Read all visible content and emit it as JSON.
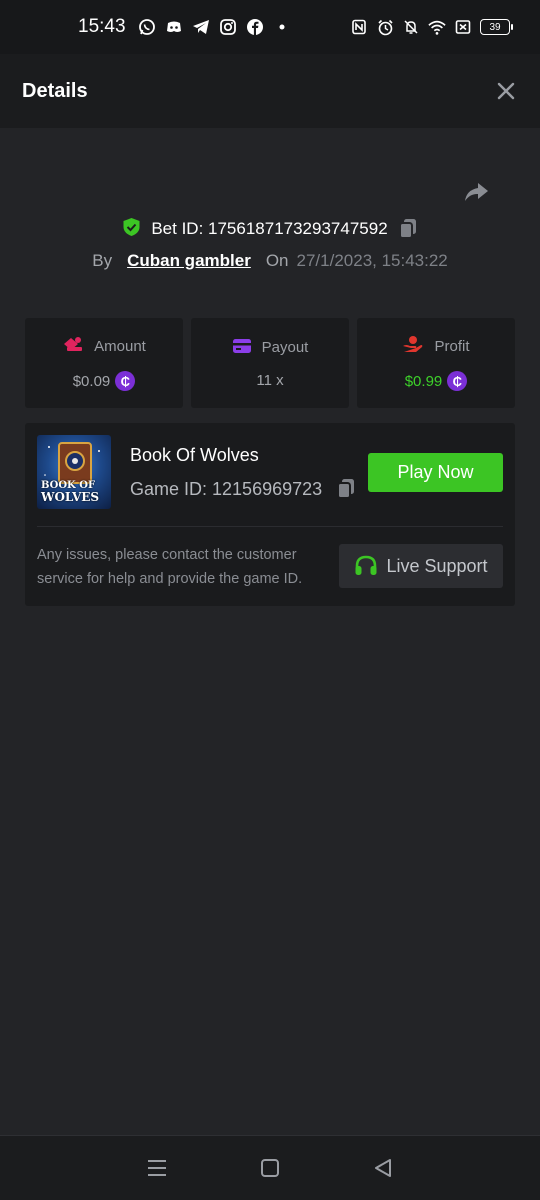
{
  "status_bar": {
    "time": "15:43",
    "battery": "39",
    "left_icons": [
      "whatsapp-icon",
      "discord-icon",
      "telegram-icon",
      "instagram-icon",
      "facebook-icon",
      "dot-icon"
    ],
    "right_icons": [
      "nfc-icon",
      "alarm-icon",
      "bell-muted-icon",
      "wifi-icon",
      "sim-off-icon",
      "battery-icon"
    ]
  },
  "header": {
    "title": "Details"
  },
  "bet": {
    "id_label": "Bet ID: 1756187173293747592",
    "by_label": "By",
    "username": "Cuban gambler",
    "on_label": "On",
    "datetime": "27/1/2023, 15:43:22"
  },
  "stats": {
    "amount": {
      "label": "Amount",
      "value": "$0.09"
    },
    "payout": {
      "label": "Payout",
      "value": "11 x"
    },
    "profit": {
      "label": "Profit",
      "value": "$0.99"
    }
  },
  "game": {
    "thumb_text_1": "BOOK OF",
    "thumb_text_2": "WOLVES",
    "title": "Book Of Wolves",
    "id_label": "Game ID: 12156969723",
    "play_label": "Play Now",
    "support_text": "Any issues, please contact the customer service for help and provide the game ID.",
    "live_support_label": "Live Support"
  },
  "colors": {
    "background": "#232427",
    "card": "#1a1b1d",
    "accent_green": "#3cc524",
    "coin_purple": "#7b2fd6"
  }
}
